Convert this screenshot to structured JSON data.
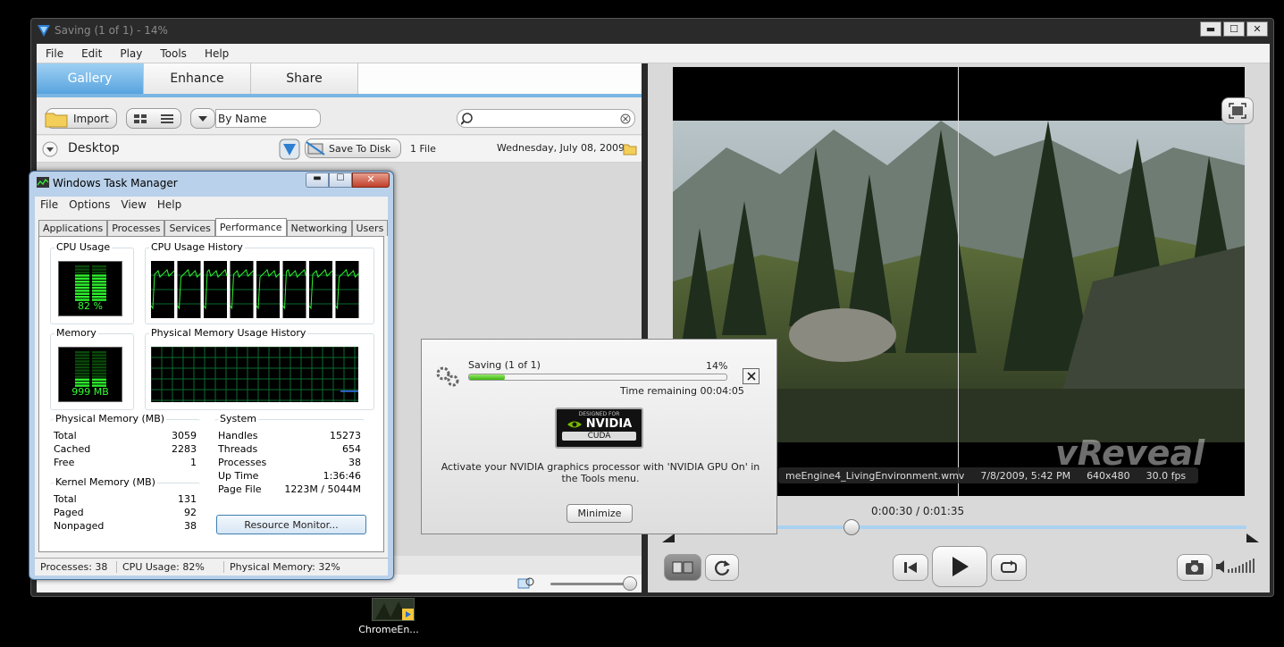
{
  "main_window": {
    "title": "Saving (1 of 1) - 14%",
    "controls": {
      "minimize": "▬",
      "maximize": "☐",
      "close": "✕"
    },
    "menu": [
      "File",
      "Edit",
      "Play",
      "Tools",
      "Help"
    ]
  },
  "left_pane": {
    "tabs": [
      "Gallery",
      "Enhance",
      "Share"
    ],
    "toolbar": {
      "import_label": "Import",
      "sort_value": "By Name",
      "search_placeholder": ""
    },
    "desktop_bar": {
      "folder": "Desktop",
      "save_label": "Save To Disk",
      "file_count": "1 File",
      "date": "Wednesday, July 08, 2009"
    }
  },
  "player": {
    "info": {
      "filename": "meEngine4_LivingEnvironment.wmv",
      "datetime": "7/8/2009, 5:42 PM",
      "resolution": "640x480",
      "fps": "30.0 fps"
    },
    "watermark": "vReveal",
    "time": "0:00:30 / 0:01:35",
    "position": 0.32
  },
  "task_manager": {
    "title": "Windows Task Manager",
    "menu": [
      "File",
      "Options",
      "View",
      "Help"
    ],
    "tabs": [
      "Applications",
      "Processes",
      "Services",
      "Performance",
      "Networking",
      "Users"
    ],
    "active_tab": "Performance",
    "cpu": {
      "label": "CPU Usage",
      "value": "82 %",
      "level": 0.82,
      "history_label": "CPU Usage History"
    },
    "memory": {
      "label": "Memory",
      "value": "999 MB",
      "level": 0.33,
      "history_label": "Physical Memory Usage History"
    },
    "physical_memory": {
      "label": "Physical Memory (MB)",
      "rows": [
        [
          "Total",
          "3059"
        ],
        [
          "Cached",
          "2283"
        ],
        [
          "Free",
          "1"
        ]
      ]
    },
    "kernel_memory": {
      "label": "Kernel Memory (MB)",
      "rows": [
        [
          "Total",
          "131"
        ],
        [
          "Paged",
          "92"
        ],
        [
          "Nonpaged",
          "38"
        ]
      ]
    },
    "system": {
      "label": "System",
      "rows": [
        [
          "Handles",
          "15273"
        ],
        [
          "Threads",
          "654"
        ],
        [
          "Processes",
          "38"
        ],
        [
          "Up Time",
          "1:36:46"
        ],
        [
          "Page File",
          "1223M / 5044M"
        ]
      ]
    },
    "resource_button": "Resource Monitor...",
    "status": {
      "processes": "Processes: 38",
      "cpu": "CPU Usage: 82%",
      "memory": "Physical Memory: 32%"
    }
  },
  "saving_dialog": {
    "status": "Saving (1 of 1)",
    "percent": "14%",
    "progress": 0.14,
    "remaining": "Time remaining 00:04:05",
    "nvidia_top": "DESIGNED FOR",
    "nvidia_brand": "NVIDIA",
    "nvidia_sub": "CUDA",
    "message": "Activate your NVIDIA graphics processor with 'NVIDIA GPU On' in the Tools menu.",
    "minimize_label": "Minimize"
  },
  "desktop_icon": {
    "label": "ChromeEn..."
  }
}
